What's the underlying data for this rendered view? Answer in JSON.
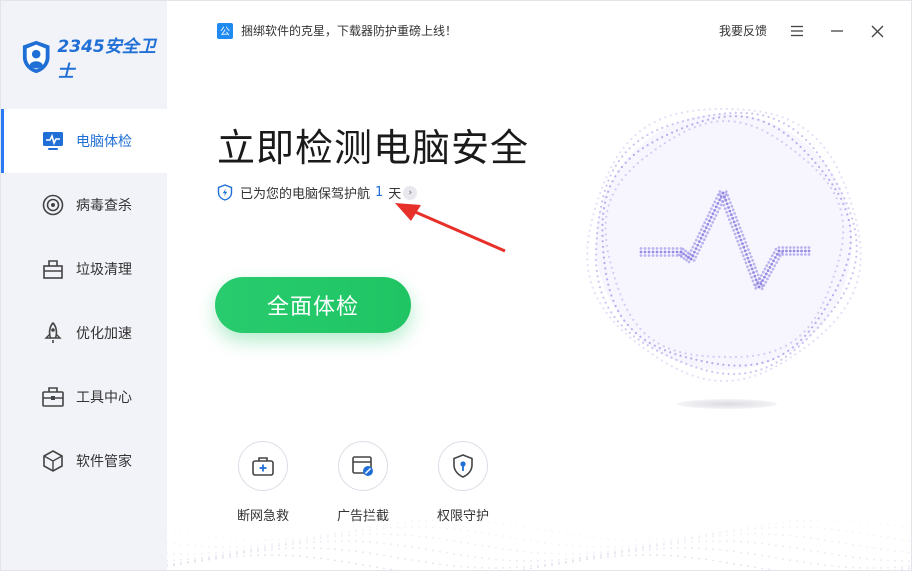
{
  "app": {
    "logo_text": "2345安全卫士"
  },
  "sidebar": {
    "items": [
      {
        "label": "电脑体检",
        "icon": "monitor-pulse-icon",
        "active": true
      },
      {
        "label": "病毒查杀",
        "icon": "target-icon",
        "active": false
      },
      {
        "label": "垃圾清理",
        "icon": "trash-box-icon",
        "active": false
      },
      {
        "label": "优化加速",
        "icon": "rocket-icon",
        "active": false
      },
      {
        "label": "工具中心",
        "icon": "toolbox-icon",
        "active": false
      },
      {
        "label": "软件管家",
        "icon": "cube-icon",
        "active": false
      }
    ]
  },
  "topbar": {
    "notice_badge": "公",
    "notice_text": "捆绑软件的克星，下载器防护重磅上线！",
    "feedback_label": "我要反馈"
  },
  "main": {
    "headline": "立即检测电脑安全",
    "protect_prefix": "已为您的电脑保驾护航",
    "protect_days": "1",
    "protect_suffix": "天",
    "scan_button": "全面体检"
  },
  "tools": [
    {
      "label": "断网急救",
      "icon": "first-aid-kit-icon"
    },
    {
      "label": "广告拦截",
      "icon": "ad-block-icon"
    },
    {
      "label": "权限守护",
      "icon": "shield-key-icon"
    }
  ],
  "colors": {
    "accent_blue": "#1f6fd6",
    "scan_green": "#22c766",
    "sidebar_bg": "#f2f3f8",
    "orb_purple": "#8b7fe0",
    "arrow_red": "#e8302a"
  }
}
